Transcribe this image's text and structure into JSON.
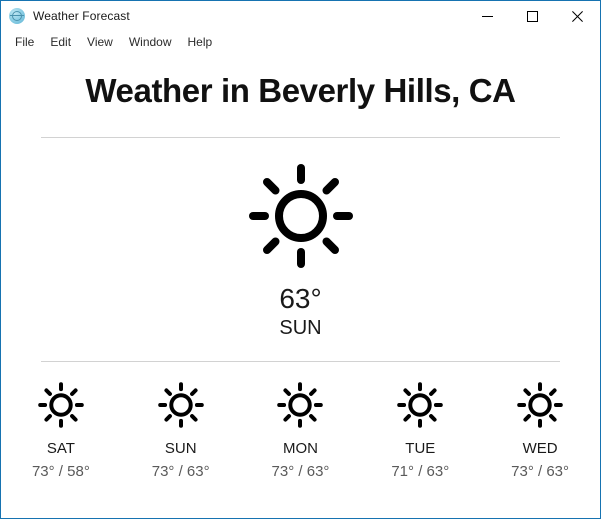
{
  "window": {
    "title": "Weather Forecast",
    "icon": "weather-globe-icon",
    "border_color": "#1673b1",
    "controls": {
      "minimize": "minimize-icon",
      "maximize": "maximize-icon",
      "close": "close-icon"
    }
  },
  "menubar": {
    "items": [
      {
        "label": "File"
      },
      {
        "label": "Edit"
      },
      {
        "label": "View"
      },
      {
        "label": "Window"
      },
      {
        "label": "Help"
      }
    ]
  },
  "main": {
    "heading": "Weather in Beverly Hills, CA",
    "current": {
      "icon": "sun-icon",
      "condition": "sunny",
      "temperature": "63°",
      "day": "SUN"
    },
    "forecast": [
      {
        "day": "SAT",
        "icon": "sun-icon",
        "condition": "sunny",
        "temps": "73° / 58°",
        "high": "73°",
        "low": "58°"
      },
      {
        "day": "SUN",
        "icon": "sun-icon",
        "condition": "sunny",
        "temps": "73° / 63°",
        "high": "73°",
        "low": "63°"
      },
      {
        "day": "MON",
        "icon": "sun-icon",
        "condition": "sunny",
        "temps": "73° / 63°",
        "high": "73°",
        "low": "63°"
      },
      {
        "day": "TUE",
        "icon": "sun-icon",
        "condition": "sunny",
        "temps": "71° / 63°",
        "high": "71°",
        "low": "63°"
      },
      {
        "day": "WED",
        "icon": "sun-icon",
        "condition": "sunny",
        "temps": "73° / 63°",
        "high": "73°",
        "low": "63°"
      }
    ]
  },
  "colors": {
    "window_border": "#1673b1",
    "divider": "#d2d2d2",
    "text_primary": "#1a1a1a",
    "text_secondary": "#5a5a5a",
    "background": "#ffffff"
  }
}
